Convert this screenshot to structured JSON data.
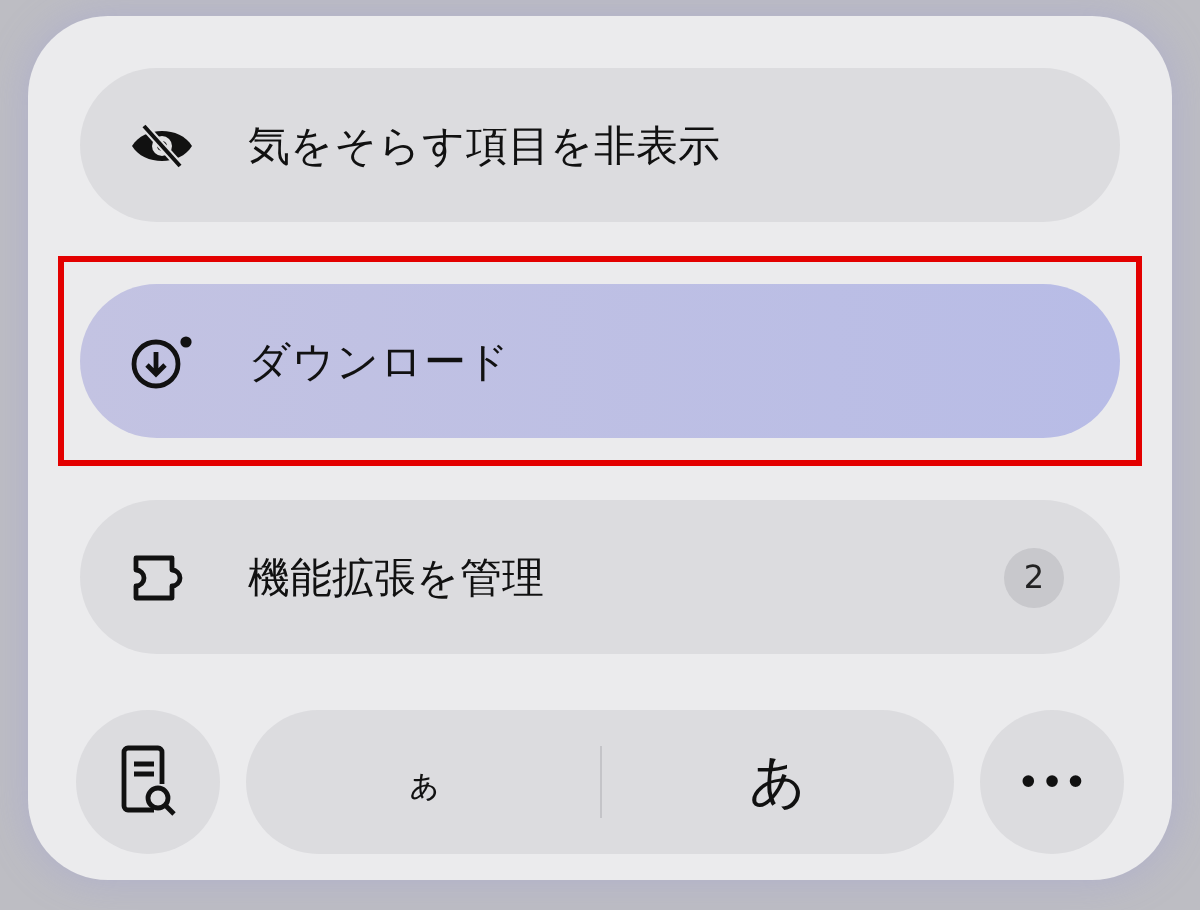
{
  "menu_items": [
    {
      "label": "気をそらす項目を非表示",
      "selected": false
    },
    {
      "label": "ダウンロード",
      "selected": true
    },
    {
      "label": "機能拡張を管理",
      "selected": false,
      "badge": "2"
    }
  ],
  "toolbar": {
    "small_text": "ぁ",
    "large_text": "あ",
    "more": "•••"
  }
}
